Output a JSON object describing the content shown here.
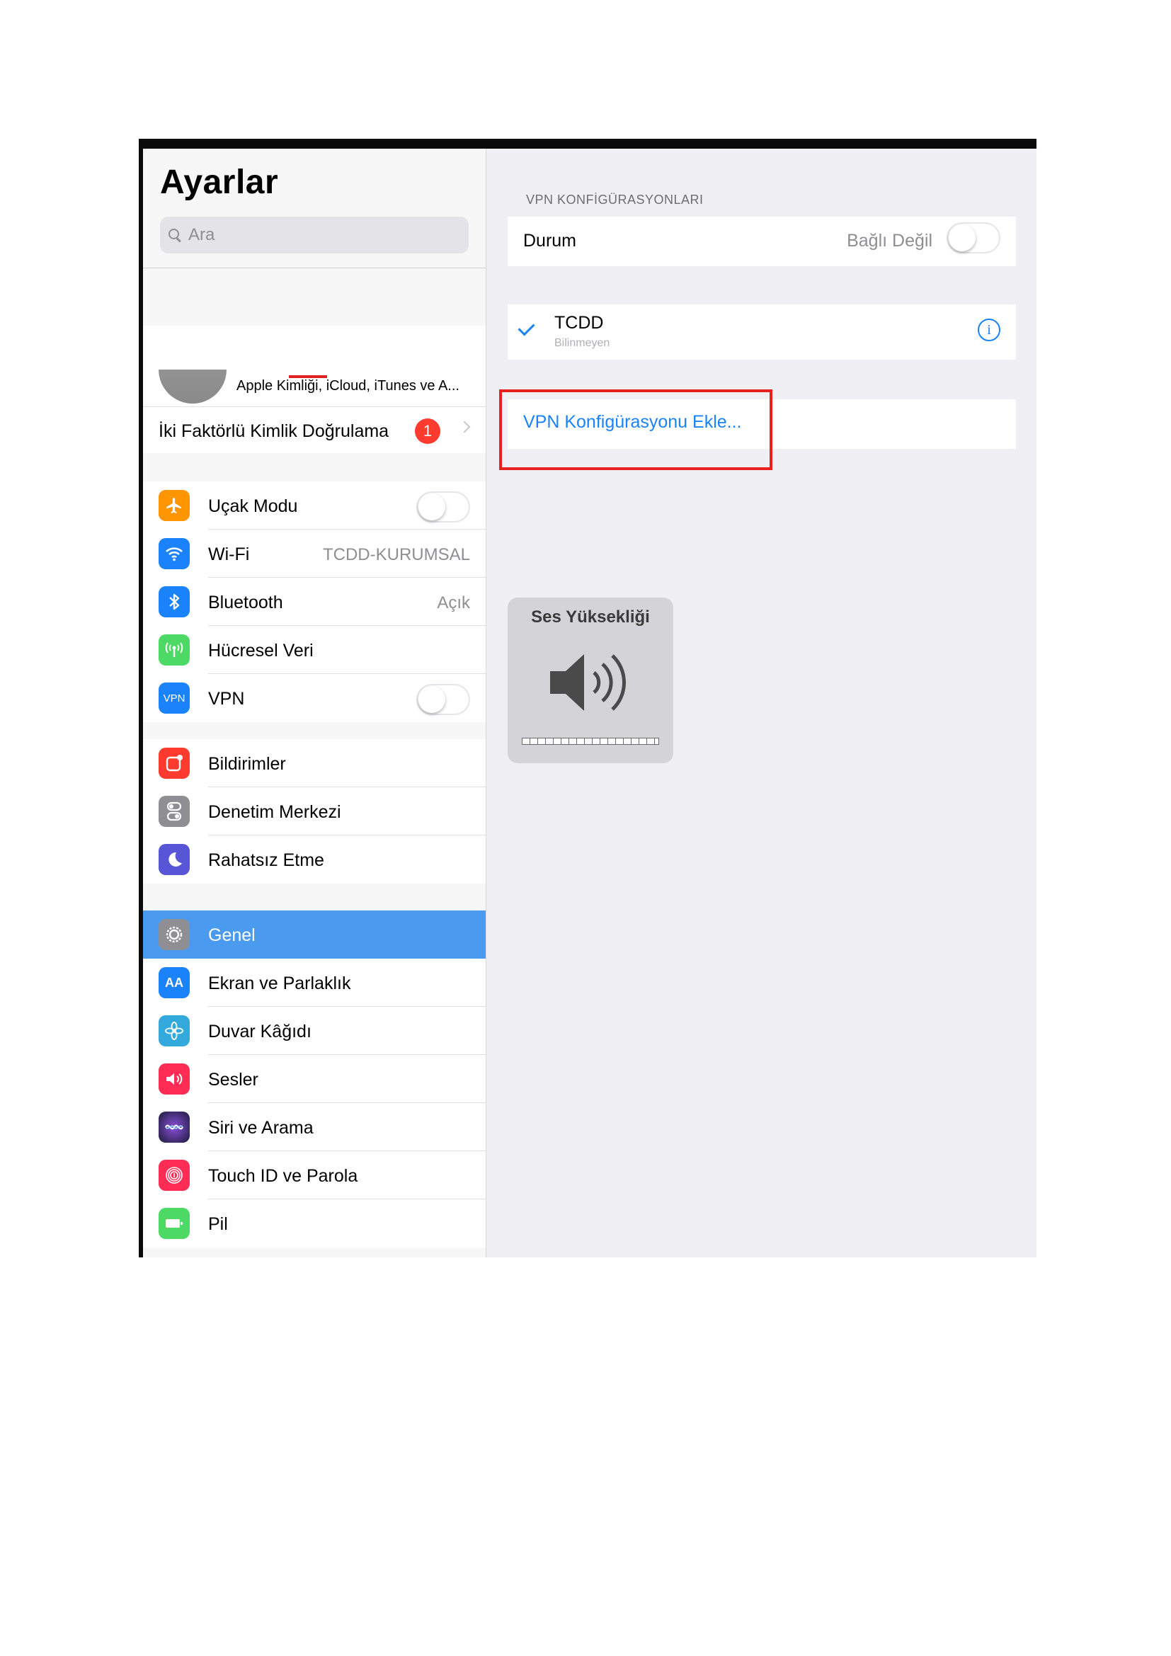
{
  "sidebar": {
    "title": "Ayarlar",
    "search_placeholder": "Ara",
    "profile": {
      "subtitle": "Apple Kimliği, iCloud, iTunes ve A...",
      "two_factor_label": "İki Faktörlü Kimlik Doğrulama",
      "two_factor_badge": "1"
    },
    "group1": [
      {
        "label": "Uçak Modu",
        "icon": "airplane-icon",
        "color": "#ff9500"
      },
      {
        "label": "Wi-Fi",
        "value": "TCDD-KURUMSAL",
        "icon": "wifi-icon",
        "color": "#1a82fb"
      },
      {
        "label": "Bluetooth",
        "value": "Açık",
        "icon": "bluetooth-icon",
        "color": "#1a82fb"
      },
      {
        "label": "Hücresel Veri",
        "icon": "cellular-icon",
        "color": "#4cd964"
      },
      {
        "label": "VPN",
        "icon_text": "VPN",
        "icon": "vpn-icon",
        "color": "#1a82fb"
      }
    ],
    "group2": [
      {
        "label": "Bildirimler",
        "icon": "notifications-icon",
        "color": "#ff3b30"
      },
      {
        "label": "Denetim Merkezi",
        "icon": "control-center-icon",
        "color": "#8e8e93"
      },
      {
        "label": "Rahatsız Etme",
        "icon": "moon-icon",
        "color": "#5856d6"
      }
    ],
    "group3": [
      {
        "label": "Genel",
        "icon": "gear-icon",
        "color": "#8e8e93",
        "selected": true
      },
      {
        "label": "Ekran ve Parlaklık",
        "icon_text": "AA",
        "icon": "display-icon",
        "color": "#1a82fb"
      },
      {
        "label": "Duvar Kâğıdı",
        "icon": "wallpaper-icon",
        "color": "#34aadc"
      },
      {
        "label": "Sesler",
        "icon": "sounds-icon",
        "color": "#ff2d55"
      },
      {
        "label": "Siri ve Arama",
        "icon": "siri-icon",
        "color": "#2c2c54"
      },
      {
        "label": "Touch ID ve Parola",
        "icon": "fingerprint-icon",
        "color": "#ff2d55"
      },
      {
        "label": "Pil",
        "icon": "battery-icon",
        "color": "#4cd964"
      }
    ]
  },
  "vpn": {
    "section_header": "VPN KONFİGÜRASYONLARI",
    "status_label": "Durum",
    "status_value": "Bağlı Değil",
    "config_name": "TCDD",
    "config_sub": "Bilinmeyen",
    "add_label": "VPN Konfigürasyonu Ekle..."
  },
  "hud": {
    "title": "Ses Yüksekliği",
    "volume_level": 0
  },
  "colors": {
    "accent": "#1a82fb",
    "selection": "#4a9bf0",
    "highlight_box": "#e8201f"
  }
}
